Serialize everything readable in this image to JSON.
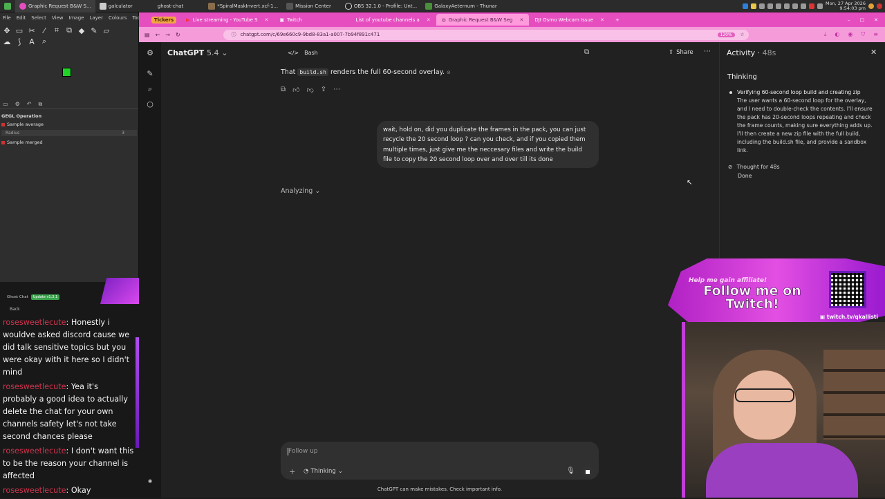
{
  "taskbar": {
    "tasks": [
      "Graphic Request B&W S...",
      "galculator",
      "ghost-chat",
      "*SpiralMaskInvert.xcf-1...",
      "Mission Center",
      "OBS 32.1.0 - Profile: Unt...",
      "GalaxyAeternum - Thunar"
    ],
    "clock_line1": "Mon, 27 Apr 2026",
    "clock_line2": "9:54:03 pm"
  },
  "gimp": {
    "menu": [
      "File",
      "Edit",
      "Select",
      "View",
      "Image",
      "Layer",
      "Colours",
      "Tools"
    ],
    "panel_title": "GEGL Operation",
    "rows": [
      "Sample average",
      "Radius",
      "Sample merged"
    ],
    "radius_value": "3"
  },
  "ghost_chat": {
    "title": "Ghost Chat",
    "version": "Update v1.3.1",
    "back": "Back",
    "messages": [
      {
        "user": "rosesweetlecute",
        "text": "Honestly i wouldve asked discord cause we did talk sensitive topics but you were okay with it here so I didn't mind"
      },
      {
        "user": "rosesweetlecute",
        "text": "Yea it's probably a good idea to actually delete the chat for your own channels safety let's not take second chances please"
      },
      {
        "user": "rosesweetlecute",
        "text": "I don't want this to be the reason your channel is affected"
      },
      {
        "user": "rosesweetlecute",
        "text": "Okay"
      }
    ]
  },
  "browser": {
    "tickers": "Tickers",
    "tabs": [
      "Live streaming - YouTube S",
      "Twitch",
      "List of youtube channels a",
      "Graphic Request B&W Seg",
      "DJI Osmo Webcam Issue"
    ],
    "url": "chatgpt.com/c/69e660c9-9bd8-83a1-a007-7b94f891c471",
    "zoom": "120%"
  },
  "chatgpt": {
    "model_name": "ChatGPT",
    "model_version": "5.4",
    "tool_label": "Bash",
    "share_label": "Share",
    "reply_pre": "That",
    "reply_code": "build.sh",
    "reply_post": "renders the full 60-second overlay.",
    "user_message": "wait, hold on, did you duplicate the frames in the pack, you can just recycle the 20 second loop ? can you check, and if you copied them multiple times, just give me the neccesary files and write the build file to copy the 20 second loop over and over till its done",
    "status": "Analyzing",
    "composer_placeholder": "Follow up",
    "thinking_mode": "Thinking",
    "disclaimer": "ChatGPT can make mistakes. Check important info."
  },
  "activity": {
    "title": "Activity",
    "duration": "48s",
    "section": "Thinking",
    "step_heading": "Verifying 60-second loop build and creating zip",
    "step_body": "The user wants a 60-second loop for the overlay, and I need to double-check the contents. I'll ensure the pack has 20-second loops repeating and check the frame counts, making sure everything adds up. I'll then create a new zip file with the full build, including the build.sh file, and provide a sandbox link.",
    "thought_for": "Thought for 48s",
    "done": "Done"
  },
  "promo": {
    "small": "Help me gain affiliate!",
    "big": "Follow me on Twitch!",
    "url": "twitch.tv/qkallisti"
  }
}
